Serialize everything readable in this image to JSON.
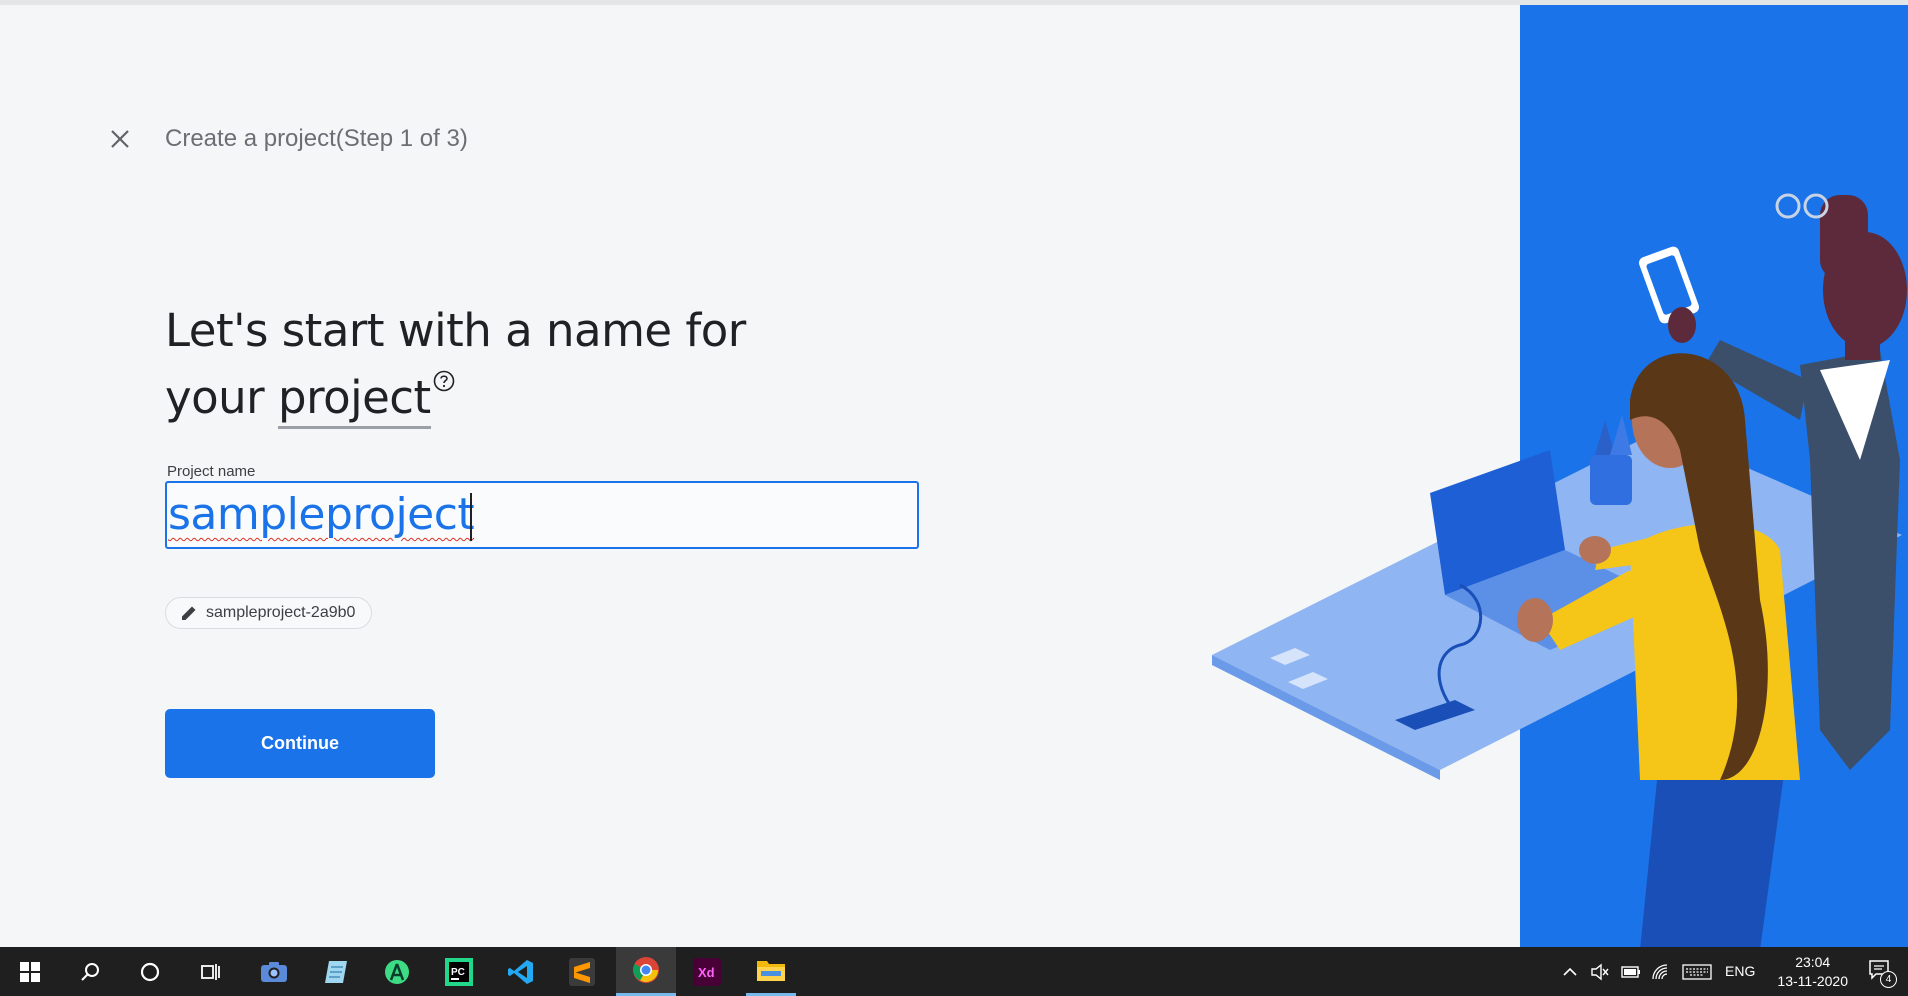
{
  "dialog": {
    "step_title": "Create a project(Step 1 of 3)",
    "headline_line1": "Let's start with a name for",
    "headline_line2_prefix": "your ",
    "headline_line2_underlined": "project",
    "field_label": "Project name",
    "field_value": "sampleproject",
    "project_id": "sampleproject-2a9b0",
    "continue_label": "Continue"
  },
  "colors": {
    "accent": "#1a73e8",
    "background": "#f5f6f7",
    "panel": "#1a73e8",
    "taskbar": "#1f1f1f"
  },
  "taskbar": {
    "apps": [
      "windows-start-icon",
      "search-icon",
      "cortana-icon",
      "task-view-icon",
      "camera-icon",
      "notepad-icon",
      "android-studio-icon",
      "pycharm-icon",
      "vscode-icon",
      "sublime-text-icon",
      "chrome-icon",
      "adobe-xd-icon",
      "file-explorer-icon"
    ],
    "pycharm_label": "PC",
    "xd_label": "Xd",
    "language": "ENG",
    "time": "23:04",
    "date": "13-11-2020",
    "notification_count": "4"
  }
}
